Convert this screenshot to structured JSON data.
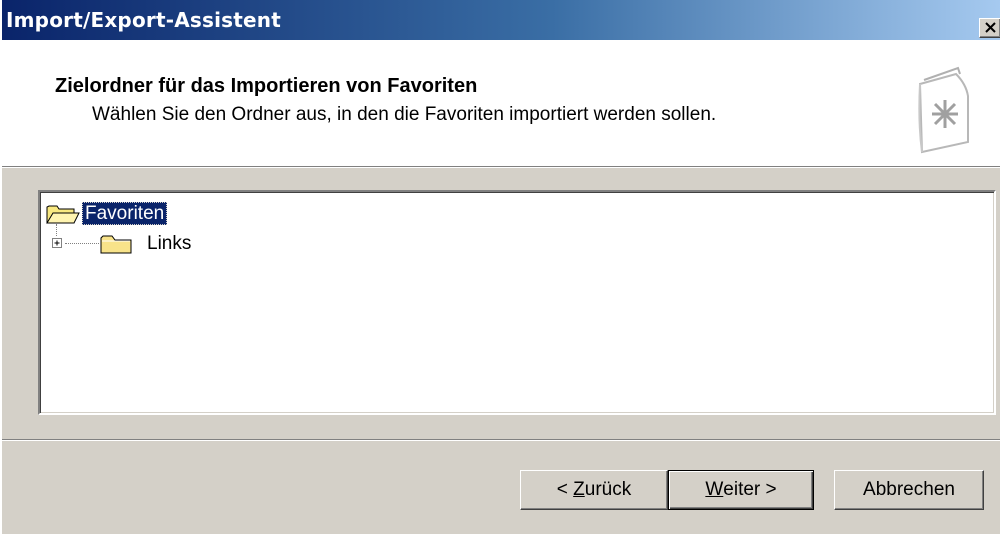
{
  "window": {
    "title": "Import/Export-Assistent",
    "close_glyph": "✕"
  },
  "header": {
    "title": "Zielordner für das Importieren von Favoriten",
    "subtitle": "Wählen Sie den Ordner aus, in den die Favoriten importiert werden sollen.",
    "icon": "wizard-favorites-icon"
  },
  "tree": {
    "items": [
      {
        "label": "Favoriten",
        "selected": true,
        "icon": "folder-open-icon",
        "expanded": true
      },
      {
        "label": "Links",
        "selected": false,
        "icon": "folder-closed-icon",
        "expander": "+"
      }
    ]
  },
  "buttons": {
    "back_prefix": "< ",
    "back_mnemonic": "Z",
    "back_rest": "urück",
    "next_mnemonic": "W",
    "next_rest": "eiter >",
    "cancel": "Abbrechen"
  },
  "colors": {
    "titlebar_start": "#0a246a",
    "titlebar_end": "#a6caf0",
    "selection": "#0a246a",
    "face": "#d4d0c8"
  }
}
